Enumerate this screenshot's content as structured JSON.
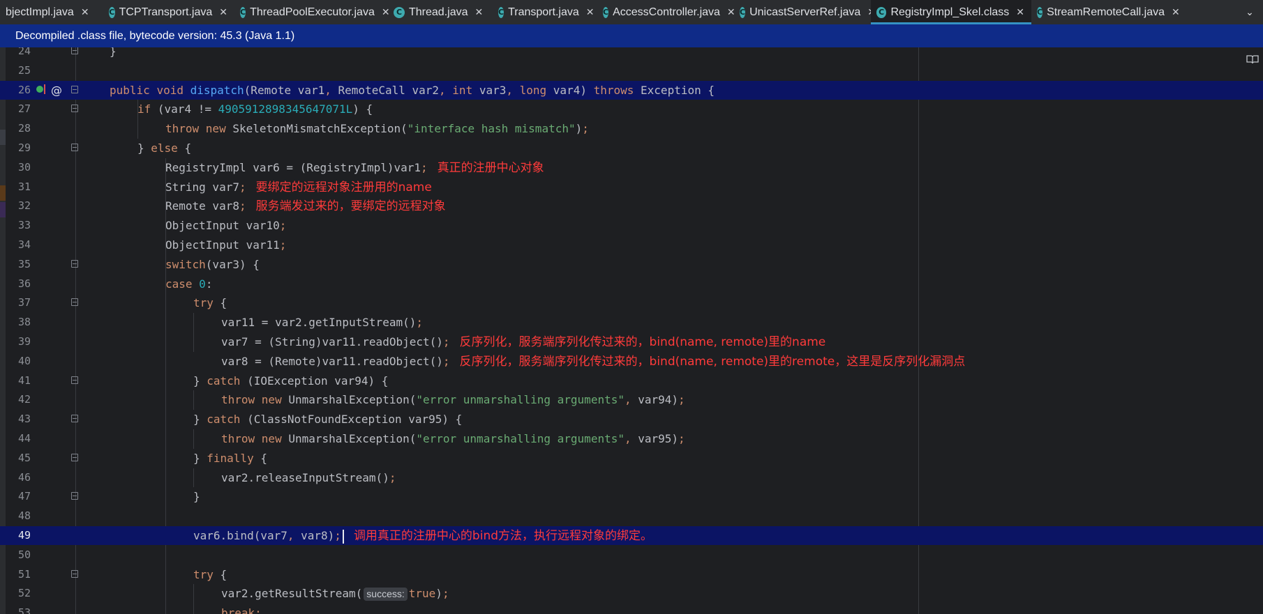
{
  "tabs": [
    {
      "label": "bjectImpl.java",
      "icon": null,
      "active": false
    },
    {
      "label": "TCPTransport.java",
      "icon": "class-icon",
      "active": false
    },
    {
      "label": "ThreadPoolExecutor.java",
      "icon": "class-icon",
      "active": false
    },
    {
      "label": "Thread.java",
      "icon": "class-icon",
      "active": false
    },
    {
      "label": "Transport.java",
      "icon": "abstract-class-icon",
      "active": false
    },
    {
      "label": "AccessController.java",
      "icon": "final-class-icon",
      "active": false
    },
    {
      "label": "UnicastServerRef.java",
      "icon": "class-icon",
      "active": false
    },
    {
      "label": "RegistryImpl_Skel.class",
      "icon": "final-class-icon",
      "active": true
    },
    {
      "label": "StreamRemoteCall.java",
      "icon": "class-icon",
      "active": false
    }
  ],
  "tab_close_glyph": "✕",
  "tab_overflow_glyph": "⌄",
  "banner": {
    "text": "Decompiled .class file, bytecode version: 45.3 (Java 1.1)"
  },
  "editor": {
    "lines": [
      {
        "n": "24",
        "code": [
          [
            "p",
            "}"
          ]
        ]
      },
      {
        "n": "25",
        "code": []
      },
      {
        "n": "26",
        "code": [
          [
            "kw",
            "public "
          ],
          [
            "kw",
            "void "
          ],
          [
            "fn",
            "dispatch"
          ],
          [
            "p",
            "(Remote var1"
          ],
          [
            "kw",
            ", "
          ],
          [
            "p",
            "RemoteCall var2"
          ],
          [
            "kw",
            ", "
          ],
          [
            "kw",
            "int "
          ],
          [
            "p",
            "var3"
          ],
          [
            "kw",
            ", "
          ],
          [
            "kw",
            "long "
          ],
          [
            "p",
            "var4) "
          ],
          [
            "kw",
            "throws "
          ],
          [
            "p",
            "Exception {"
          ]
        ]
      },
      {
        "n": "27",
        "code": [
          [
            "kw",
            "if "
          ],
          [
            "p",
            "(var4 != "
          ],
          [
            "num",
            "4905912898345647071L"
          ],
          [
            "p",
            ") {"
          ]
        ]
      },
      {
        "n": "28",
        "code": [
          [
            "kw",
            "throw new "
          ],
          [
            "p",
            "SkeletonMismatchException("
          ],
          [
            "str",
            "\"interface hash mismatch\""
          ],
          [
            "p",
            ")"
          ],
          [
            "kw",
            ";"
          ]
        ]
      },
      {
        "n": "29",
        "code": [
          [
            "p",
            "} "
          ],
          [
            "kw",
            "else "
          ],
          [
            "p",
            "{"
          ]
        ]
      },
      {
        "n": "30",
        "code": [
          [
            "p",
            "RegistryImpl var6 = (RegistryImpl)var1"
          ],
          [
            "kw",
            ";"
          ]
        ],
        "comment": "真正的注册中心对象"
      },
      {
        "n": "31",
        "code": [
          [
            "p",
            "String var7"
          ],
          [
            "kw",
            ";"
          ]
        ],
        "comment": "要绑定的远程对象注册用的name"
      },
      {
        "n": "32",
        "code": [
          [
            "p",
            "Remote var8"
          ],
          [
            "kw",
            ";"
          ]
        ],
        "comment": "服务端发过来的，要绑定的远程对象"
      },
      {
        "n": "33",
        "code": [
          [
            "p",
            "ObjectInput var10"
          ],
          [
            "kw",
            ";"
          ]
        ]
      },
      {
        "n": "34",
        "code": [
          [
            "p",
            "ObjectInput var11"
          ],
          [
            "kw",
            ";"
          ]
        ]
      },
      {
        "n": "35",
        "code": [
          [
            "kw",
            "switch"
          ],
          [
            "p",
            "(var3) {"
          ]
        ]
      },
      {
        "n": "36",
        "code": [
          [
            "kw",
            "case "
          ],
          [
            "num",
            "0"
          ],
          [
            "p",
            ":"
          ]
        ]
      },
      {
        "n": "37",
        "code": [
          [
            "kw",
            "try "
          ],
          [
            "p",
            "{"
          ]
        ]
      },
      {
        "n": "38",
        "code": [
          [
            "p",
            "var11 = var2.getInputStream()"
          ],
          [
            "kw",
            ";"
          ]
        ]
      },
      {
        "n": "39",
        "code": [
          [
            "p",
            "var7 = (String)var11.readObject()"
          ],
          [
            "kw",
            ";"
          ]
        ],
        "comment": "反序列化，服务端序列化传过来的，bind(name, remote)里的name"
      },
      {
        "n": "40",
        "code": [
          [
            "p",
            "var8 = (Remote)var11.readObject()"
          ],
          [
            "kw",
            ";"
          ]
        ],
        "comment": "反序列化，服务端序列化传过来的，bind(name, remote)里的remote，这里是反序列化漏洞点"
      },
      {
        "n": "41",
        "code": [
          [
            "p",
            "} "
          ],
          [
            "kw",
            "catch "
          ],
          [
            "p",
            "(IOException var94) {"
          ]
        ]
      },
      {
        "n": "42",
        "code": [
          [
            "kw",
            "throw new "
          ],
          [
            "p",
            "UnmarshalException("
          ],
          [
            "str",
            "\"error unmarshalling arguments\""
          ],
          [
            "kw",
            ", "
          ],
          [
            "p",
            "var94)"
          ],
          [
            "kw",
            ";"
          ]
        ]
      },
      {
        "n": "43",
        "code": [
          [
            "p",
            "} "
          ],
          [
            "kw",
            "catch "
          ],
          [
            "p",
            "(ClassNotFoundException var95) {"
          ]
        ]
      },
      {
        "n": "44",
        "code": [
          [
            "kw",
            "throw new "
          ],
          [
            "p",
            "UnmarshalException("
          ],
          [
            "str",
            "\"error unmarshalling arguments\""
          ],
          [
            "kw",
            ", "
          ],
          [
            "p",
            "var95)"
          ],
          [
            "kw",
            ";"
          ]
        ]
      },
      {
        "n": "45",
        "code": [
          [
            "p",
            "} "
          ],
          [
            "kw",
            "finally "
          ],
          [
            "p",
            "{"
          ]
        ]
      },
      {
        "n": "46",
        "code": [
          [
            "p",
            "var2.releaseInputStream()"
          ],
          [
            "kw",
            ";"
          ]
        ]
      },
      {
        "n": "47",
        "code": [
          [
            "p",
            "}"
          ]
        ]
      },
      {
        "n": "48",
        "code": []
      },
      {
        "n": "49",
        "code": [
          [
            "p",
            "var6.bind(var7"
          ],
          [
            "kw",
            ", "
          ],
          [
            "p",
            "var8)"
          ],
          [
            "kw",
            ";"
          ]
        ],
        "comment": "调用真正的注册中心的bind方法，执行远程对象的绑定。"
      },
      {
        "n": "50",
        "code": []
      },
      {
        "n": "51",
        "code": [
          [
            "kw",
            "try "
          ],
          [
            "p",
            "{"
          ]
        ]
      },
      {
        "n": "52",
        "code": [
          [
            "p",
            "var2.getResultStream("
          ],
          [
            "hint",
            "success:"
          ],
          [
            "kw",
            "true"
          ],
          [
            "p",
            ")"
          ],
          [
            "kw",
            ";"
          ]
        ]
      },
      {
        "n": "53",
        "code": [
          [
            "kw",
            "break"
          ],
          [
            "kw",
            ";"
          ]
        ]
      }
    ]
  },
  "colors": {
    "keyword": "#cf8e6d",
    "method": "#56a8f5",
    "string": "#6aab73",
    "number": "#2aacb8",
    "comment": "#ff3b3b",
    "banner_bg": "#0f2b88",
    "highlight": "#0b1464"
  }
}
